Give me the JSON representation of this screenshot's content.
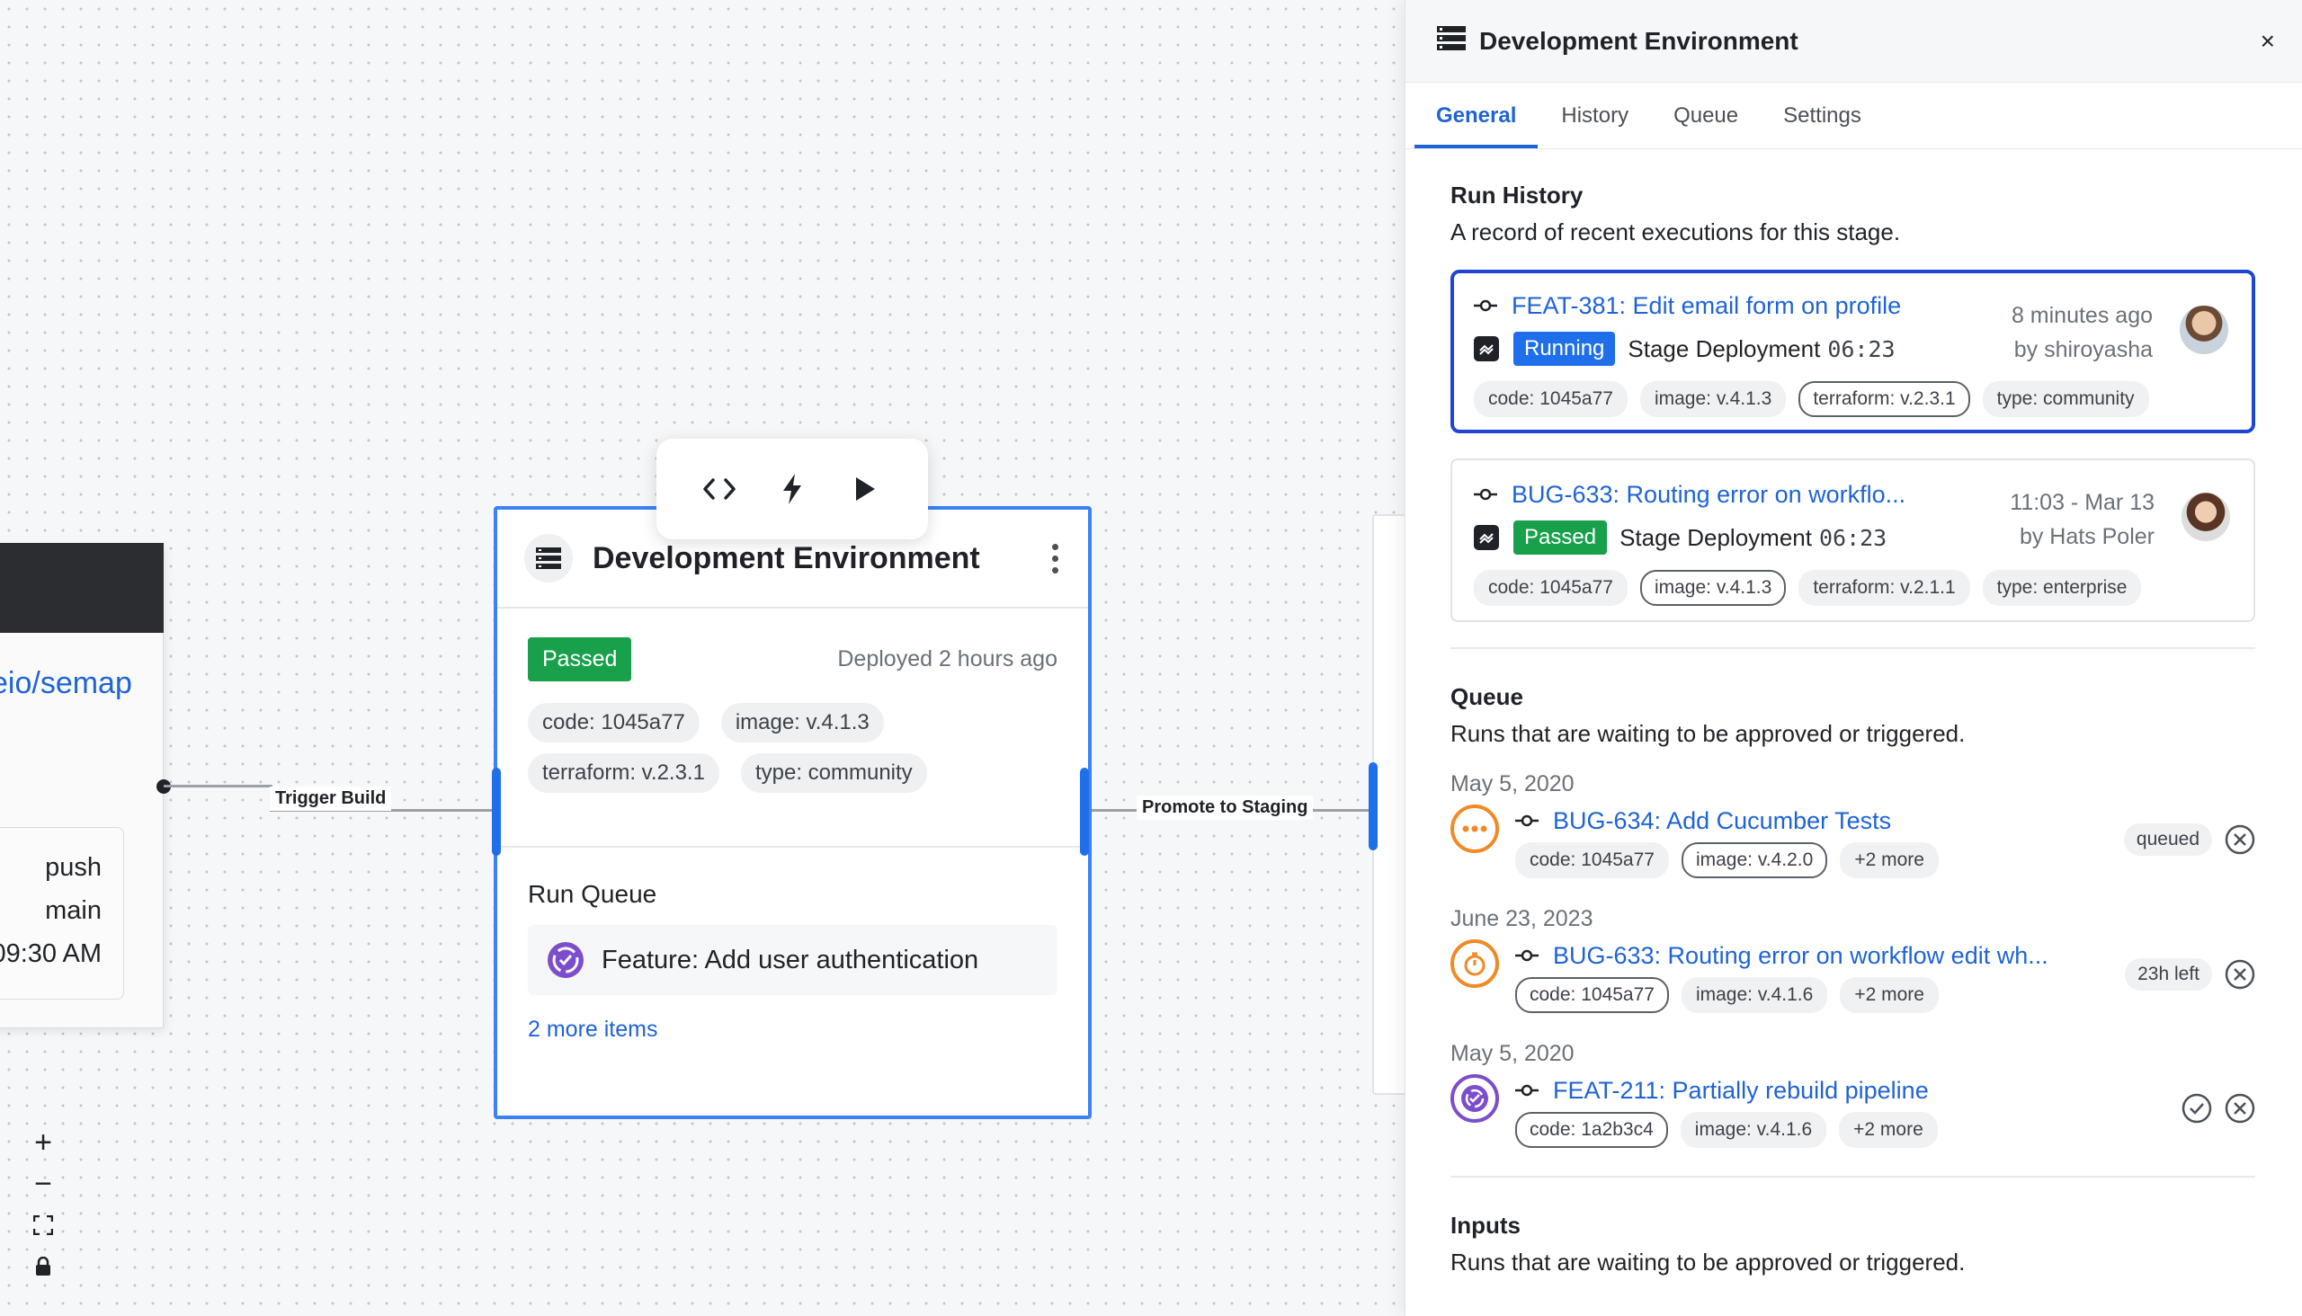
{
  "canvas": {
    "left_node": {
      "repo_link": "eio/semap",
      "trigger_lines": [
        "push",
        "main",
        "09:30 AM"
      ]
    },
    "edges": {
      "trigger_build": "Trigger Build",
      "promote_to_staging": "Promote to Staging"
    },
    "toolbar": {
      "code_icon": "code-icon",
      "bolt_icon": "bolt-icon",
      "play_icon": "play-icon"
    },
    "node": {
      "title": "Development Environment",
      "status": "Passed",
      "deployed": "Deployed 2 hours ago",
      "tags": [
        "code: 1045a77",
        "image: v.4.1.3",
        "terraform: v.2.3.1",
        "type: community"
      ],
      "queue_title": "Run Queue",
      "queue_item": "Feature: Add user authentication",
      "more_items": "2 more items"
    },
    "zoom": {
      "in": "+",
      "out": "−"
    }
  },
  "panel": {
    "title": "Development Environment",
    "close": "×",
    "tabs": [
      "General",
      "History",
      "Queue",
      "Settings"
    ],
    "run_history": {
      "title": "Run History",
      "desc": "A record of recent executions for this stage.",
      "runs": [
        {
          "title": "FEAT-381: Edit email form on profile",
          "status": "Running",
          "stage": "Stage Deployment",
          "timer": "06:23",
          "time": "8 minutes ago",
          "by": "by shiroyasha",
          "tags": [
            "code: 1045a77",
            "image: v.4.1.3",
            "terraform: v.2.3.1",
            "type: community"
          ]
        },
        {
          "title": "BUG-633: Routing error on workflo...",
          "status": "Passed",
          "stage": "Stage Deployment",
          "timer": "06:23",
          "time": "11:03 - Mar 13",
          "by": "by Hats Poler",
          "tags": [
            "code: 1045a77",
            "image: v.4.1.3",
            "terraform: v.2.1.1",
            "type: enterprise"
          ]
        }
      ]
    },
    "queue": {
      "title": "Queue",
      "desc": "Runs that are waiting to be approved or triggered.",
      "items": [
        {
          "date": "May 5, 2020",
          "title": "BUG-634: Add Cucumber Tests",
          "tags": [
            "code: 1045a77",
            "image: v.4.2.0",
            "+2 more"
          ],
          "state": "queued"
        },
        {
          "date": "June 23, 2023",
          "title": "BUG-633: Routing error on workflow edit wh...",
          "tags": [
            "code: 1045a77",
            "image: v.4.1.6",
            "+2 more"
          ],
          "state": "23h left"
        },
        {
          "date": "May 5, 2020",
          "title": "FEAT-211: Partially rebuild pipeline",
          "tags": [
            "code: 1a2b3c4",
            "image: v.4.1.6",
            "+2 more"
          ],
          "state": ""
        }
      ]
    },
    "inputs": {
      "title": "Inputs",
      "desc": "Runs that are waiting to be approved or triggered."
    }
  },
  "colors": {
    "accent": "#1f63d6",
    "selected_border": "#1f46d1",
    "node_border": "#3b82f6",
    "passed": "#18a04b",
    "running": "#1f6feb",
    "queued_orange": "#f08a24",
    "purple": "#7c4dcc"
  }
}
